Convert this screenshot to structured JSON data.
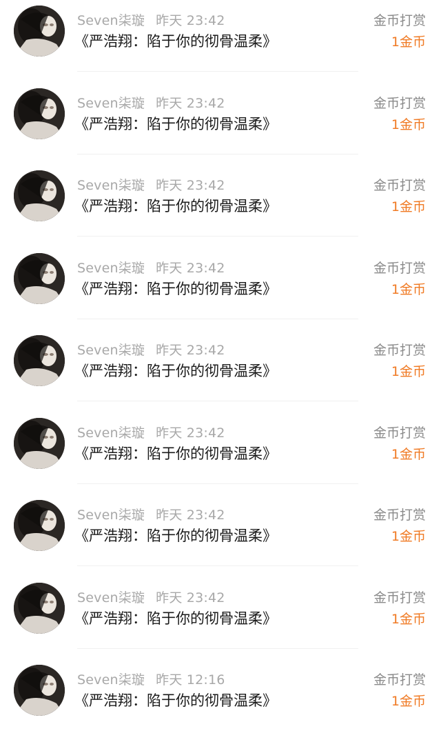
{
  "records": [
    {
      "username": "Seven柒璇",
      "time": "昨天 23:42",
      "title": "《严浩翔：陷于你的彻骨温柔》",
      "type": "金币打赏",
      "amount": "1金币"
    },
    {
      "username": "Seven柒璇",
      "time": "昨天 23:42",
      "title": "《严浩翔：陷于你的彻骨温柔》",
      "type": "金币打赏",
      "amount": "1金币"
    },
    {
      "username": "Seven柒璇",
      "time": "昨天 23:42",
      "title": "《严浩翔：陷于你的彻骨温柔》",
      "type": "金币打赏",
      "amount": "1金币"
    },
    {
      "username": "Seven柒璇",
      "time": "昨天 23:42",
      "title": "《严浩翔：陷于你的彻骨温柔》",
      "type": "金币打赏",
      "amount": "1金币"
    },
    {
      "username": "Seven柒璇",
      "time": "昨天 23:42",
      "title": "《严浩翔：陷于你的彻骨温柔》",
      "type": "金币打赏",
      "amount": "1金币"
    },
    {
      "username": "Seven柒璇",
      "time": "昨天 23:42",
      "title": "《严浩翔：陷于你的彻骨温柔》",
      "type": "金币打赏",
      "amount": "1金币"
    },
    {
      "username": "Seven柒璇",
      "time": "昨天 23:42",
      "title": "《严浩翔：陷于你的彻骨温柔》",
      "type": "金币打赏",
      "amount": "1金币"
    },
    {
      "username": "Seven柒璇",
      "time": "昨天 23:42",
      "title": "《严浩翔：陷于你的彻骨温柔》",
      "type": "金币打赏",
      "amount": "1金币"
    },
    {
      "username": "Seven柒璇",
      "time": "昨天 12:16",
      "title": "《严浩翔：陷于你的彻骨温柔》",
      "type": "金币打赏",
      "amount": "1金币"
    }
  ],
  "colors": {
    "amount": "#f07a24",
    "meta": "#a8a8a8",
    "title": "#1a1a1a"
  }
}
